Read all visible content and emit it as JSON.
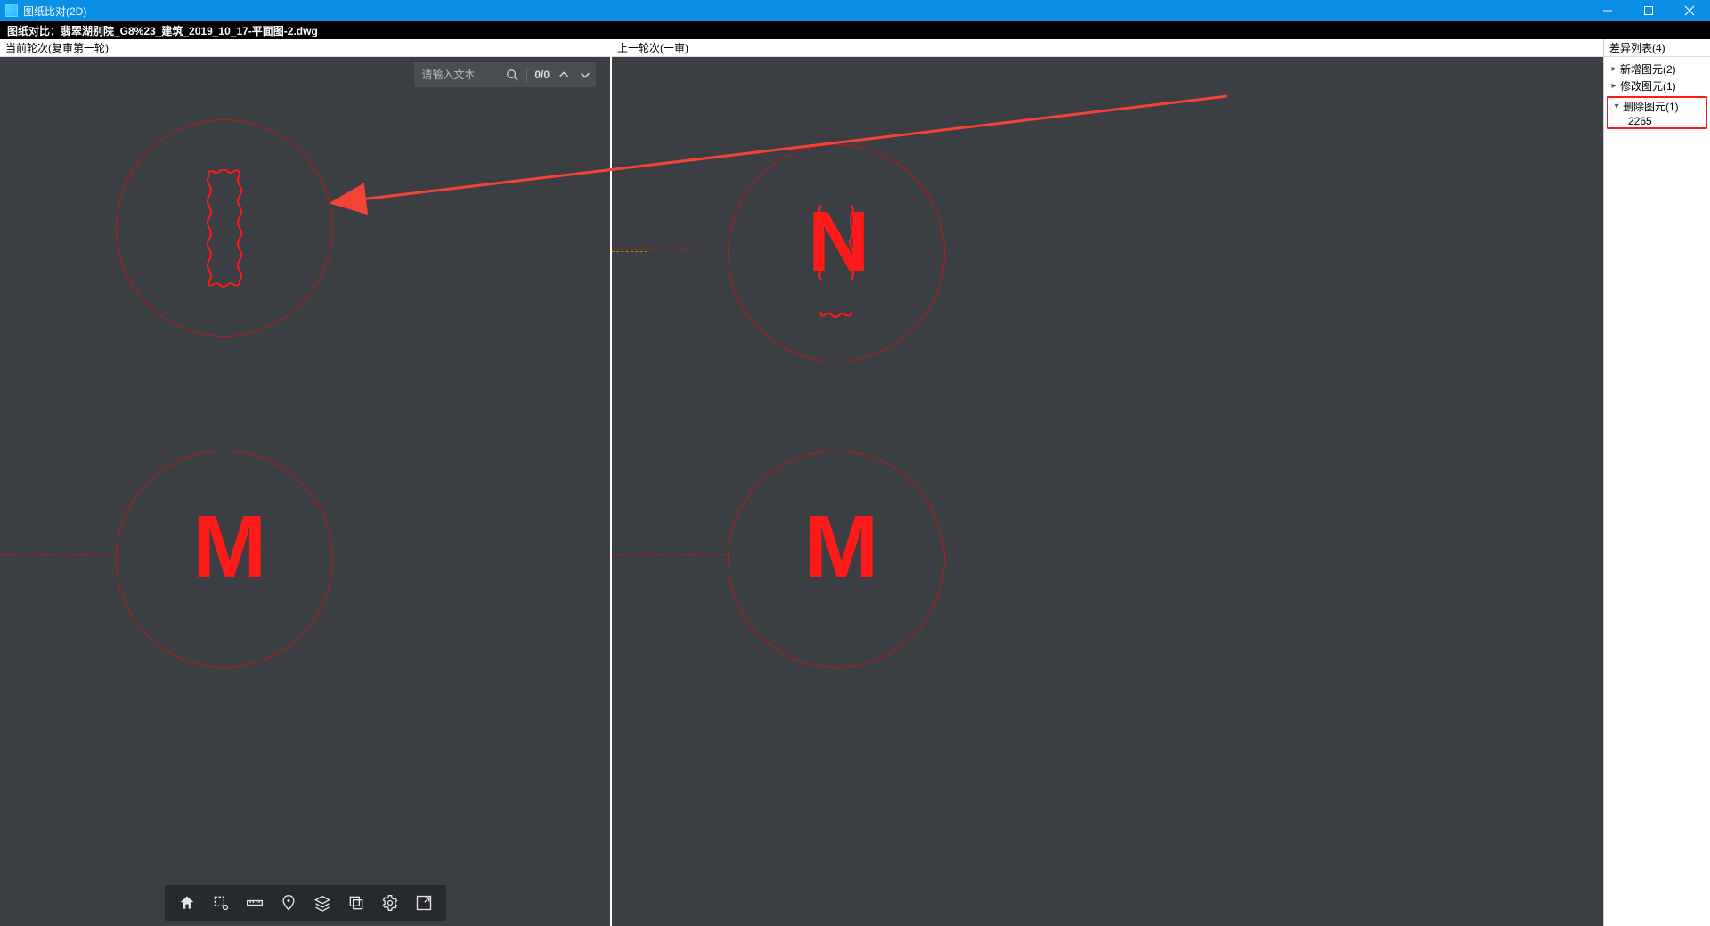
{
  "titlebar": {
    "title": "图纸比对(2D)"
  },
  "subheader": {
    "text": "图纸对比：翡翠湖别院_G8%23_建筑_2019_10_17-平面图-2.dwg"
  },
  "panels": {
    "left_header": "当前轮次(复审第一轮)",
    "right_header": "上一轮次(一审)"
  },
  "search": {
    "placeholder": "请输入文本",
    "counter": "0/0"
  },
  "drawing": {
    "left": {
      "letter_bottom": "M"
    },
    "right": {
      "letter_top": "N",
      "letter_bottom": "M"
    }
  },
  "sidepanel": {
    "header": "差异列表(4)",
    "items": [
      {
        "label": "新增图元(2)"
      },
      {
        "label": "修改图元(1)"
      }
    ],
    "selected": {
      "label": "删除图元(1)",
      "child": "2265"
    }
  }
}
